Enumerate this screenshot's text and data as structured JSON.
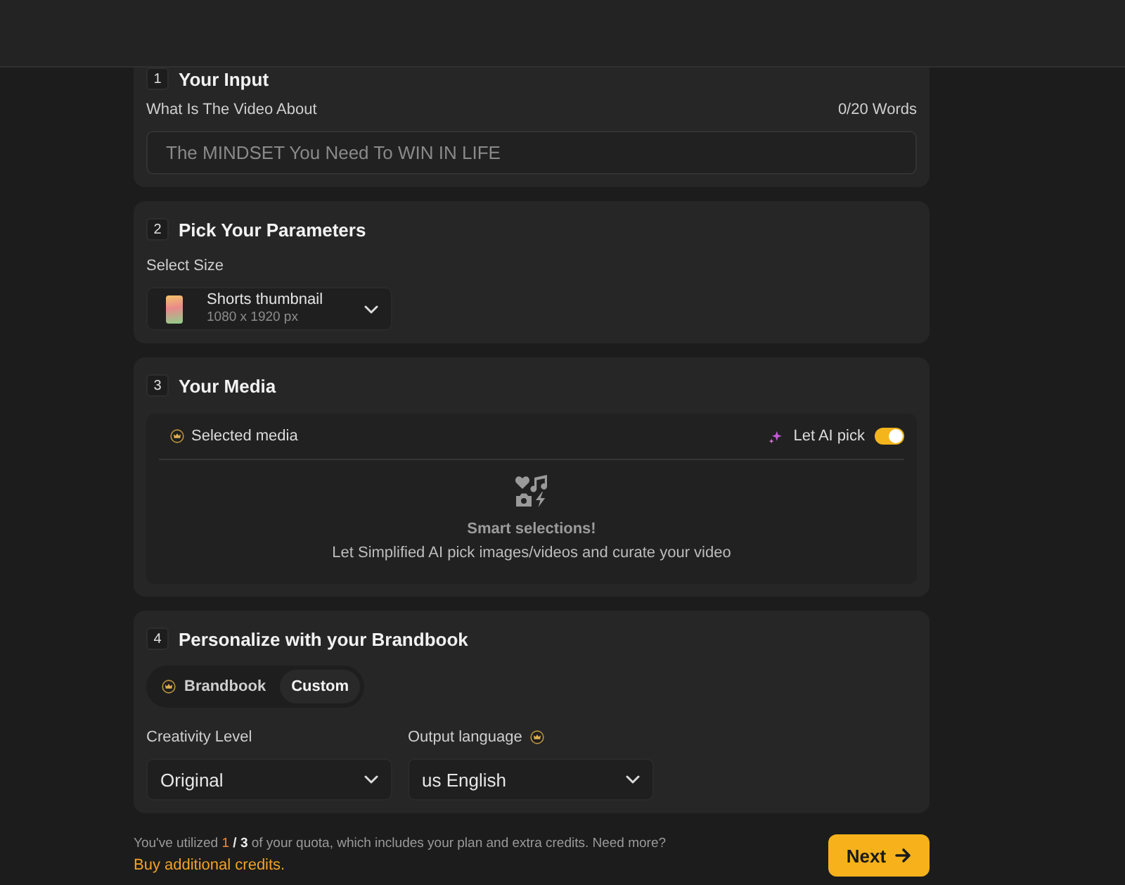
{
  "sections": [
    {
      "kind": "input",
      "number": "1",
      "title": "Your Input",
      "label": "What Is The Video About",
      "counter": "0/20 Words",
      "placeholder": "The MINDSET You Need To WIN IN LIFE"
    },
    {
      "kind": "size",
      "number": "2",
      "title": "Pick Your Parameters",
      "label": "Select Size",
      "select": {
        "name": "Shorts thumbnail",
        "dimensions": "1080 x 1920 px"
      }
    },
    {
      "kind": "media",
      "number": "3",
      "title": "Your Media",
      "selected_label": "Selected media",
      "ai_pick": {
        "label": "Let AI pick",
        "on": true
      },
      "empty_title": "Smart selections!",
      "empty_text": "Let Simplified AI pick images/videos and curate your video"
    },
    {
      "kind": "brand",
      "number": "4",
      "title": "Personalize with your Brandbook",
      "options": [
        {
          "label": "Brandbook",
          "premium": true,
          "selected": false
        },
        {
          "label": "Custom",
          "premium": false,
          "selected": true
        }
      ],
      "fields": [
        {
          "label": "Creativity Level",
          "value": "Original",
          "premium": false
        },
        {
          "label": "Output language",
          "value": "us English",
          "premium": true
        }
      ]
    }
  ],
  "footer": {
    "quota": {
      "prefix": "You've utilized",
      "used": "1",
      "total": "/ 3",
      "suffix": "of your quota, which includes your plan and extra credits. Need more?"
    },
    "link": "Buy additional credits.",
    "button": "Next"
  }
}
